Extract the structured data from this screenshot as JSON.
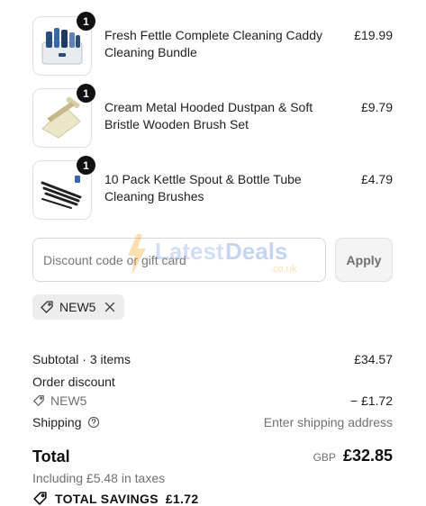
{
  "items": [
    {
      "name": "Fresh Fettle Complete Cleaning Caddy Cleaning Bundle",
      "price": "£19.99",
      "quantity": "1"
    },
    {
      "name": "Cream Metal Hooded Dustpan & Soft Bristle Wooden Brush Set",
      "price": "£9.79",
      "quantity": "1"
    },
    {
      "name": "10 Pack Kettle Spout & Bottle Tube Cleaning Brushes",
      "price": "£4.79",
      "quantity": "1"
    }
  ],
  "discount": {
    "placeholder": "Discount code or gift card",
    "apply_label": "Apply",
    "applied_code": "NEW5"
  },
  "summary": {
    "subtotal_label": "Subtotal · 3 items",
    "subtotal_value": "£34.57",
    "order_discount_label": "Order discount",
    "discount_code": "NEW5",
    "discount_value": "− £1.72",
    "shipping_label": "Shipping",
    "shipping_value": "Enter shipping address",
    "total_label": "Total",
    "currency": "GBP",
    "total_value": "£32.85",
    "taxes_note": "Including £5.48 in taxes",
    "savings_label": "TOTAL SAVINGS",
    "savings_value": "£1.72"
  },
  "watermark": {
    "word1": "Latest",
    "word2": "Deals",
    "domain": ".co.uk"
  },
  "colors": {
    "accent_orange": "#f5a623",
    "badge": "#111111",
    "chip_bg": "#ededed"
  },
  "icons": [
    "tag-icon",
    "close-icon",
    "help-circle-icon"
  ]
}
